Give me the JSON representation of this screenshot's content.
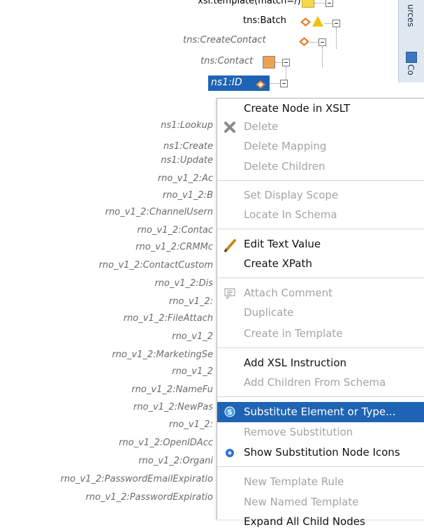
{
  "tree_top": {
    "row0": "xsl:template(match=/)",
    "row1": "tns:Batch",
    "row2": "tns:CreateContact",
    "row3": "tns:Contact",
    "row4_selected": "ns1:ID"
  },
  "tree_left": [
    "ns1:Lookup",
    "ns1:Create",
    "ns1:Update",
    "rno_v1_2:Ac",
    "rno_v1_2:B",
    "rno_v1_2:ChannelUsern",
    "rno_v1_2:Contac",
    "rno_v1_2:CRMMc",
    "rno_v1_2:ContactCustom",
    "rno_v1_2:Dis",
    "rno_v1_2:",
    "rno_v1_2:FileAttach",
    "rno_v1_2",
    "rno_v1_2:MarketingSe",
    "rno_v1_2",
    "rno_v1_2:NameFu",
    "rno_v1_2:NewPas",
    "rno_v1_2:",
    "rno_v1_2:OpenIDAcc",
    "rno_v1_2:Organi",
    "rno_v1_2:PasswordEmailExpiratio",
    "rno_v1_2:PasswordExpiratio"
  ],
  "right_panel": {
    "tab1": "urces",
    "tab2": "Co"
  },
  "context_menu": {
    "create_node": "Create Node in XSLT",
    "delete": "Delete",
    "delete_mapping": "Delete Mapping",
    "delete_children": "Delete Children",
    "set_display_scope": "Set Display Scope",
    "locate_in_schema": "Locate In Schema",
    "edit_text_value": "Edit Text Value",
    "create_xpath": "Create XPath",
    "attach_comment": "Attach Comment",
    "duplicate": "Duplicate",
    "create_in_template": "Create in Template",
    "add_xsl_instruction": "Add XSL Instruction",
    "add_children_from_schema": "Add Children From Schema",
    "substitute_element": "Substitute Element or Type...",
    "remove_substitution": "Remove Substitution",
    "show_substitution_icons": "Show Substitution Node Icons",
    "new_template_rule": "New Template Rule",
    "new_named_template": "New Named Template",
    "expand_all_child_nodes": "Expand All Child Nodes"
  },
  "colors": {
    "highlight": "#1f64b4",
    "disabled_text": "#a3a3a3",
    "tree_gray": "#6b6b6b"
  },
  "icons": {
    "delete": "x-icon",
    "edit_text": "pencil-icon",
    "attach_comment": "speech-bubble-icon",
    "substitute": "s-circle-icon",
    "show_substitution": "gear-dot-icon"
  }
}
